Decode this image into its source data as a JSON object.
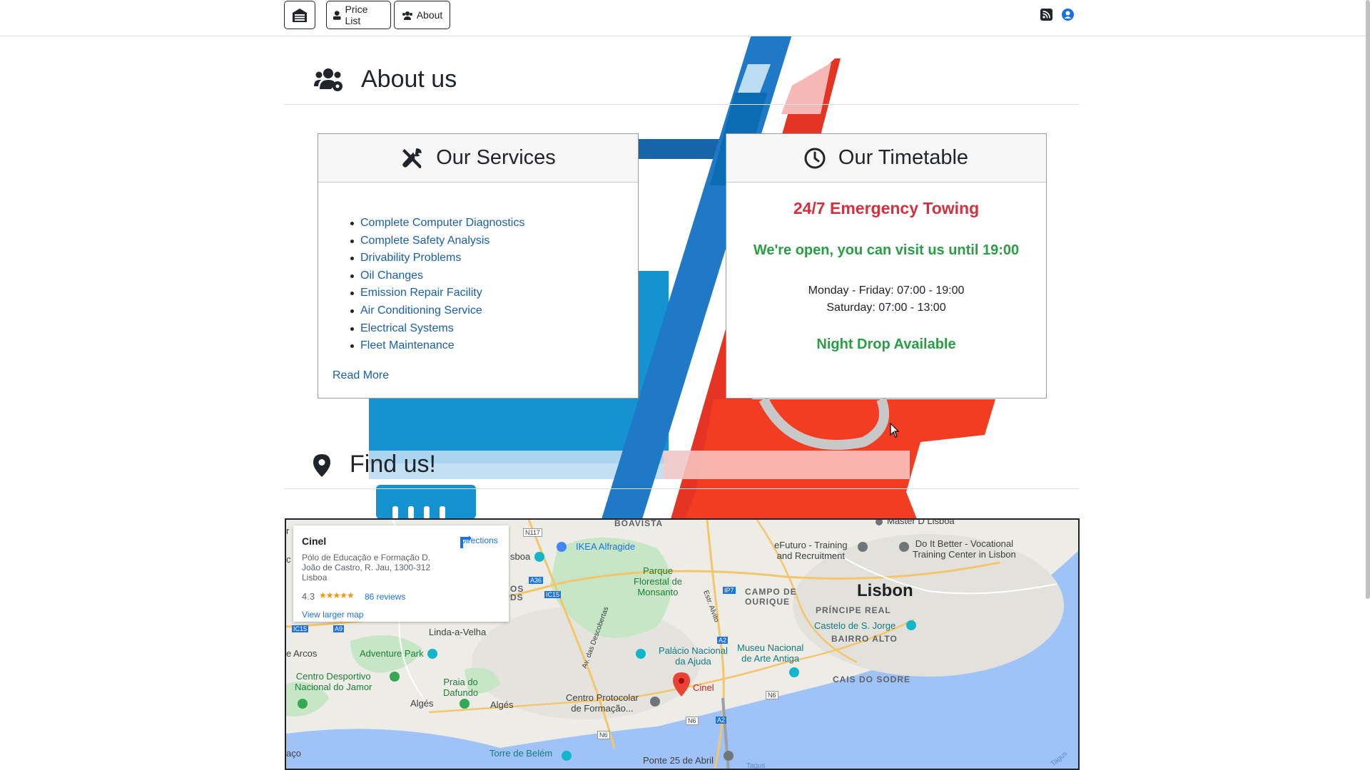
{
  "navbar": {
    "home_icon": "garage-icon",
    "price_list_label": "Price List",
    "about_label": "About",
    "rss_icon": "rss-icon",
    "account_icon": "user-circle-icon"
  },
  "about_section": {
    "title": "About us",
    "icon": "users-gear-icon"
  },
  "services_card": {
    "title": "Our Services",
    "icon": "tools-icon",
    "items": [
      "Complete Computer Diagnostics",
      "Complete Safety Analysis",
      "Drivability Problems",
      "Oil Changes",
      "Emission Repair Facility",
      "Air Conditioning Service",
      "Electrical Systems",
      "Fleet Maintenance"
    ],
    "read_more": "Read More"
  },
  "timetable_card": {
    "title": "Our Timetable",
    "icon": "clock-icon",
    "emergency": "24/7 Emergency Towing",
    "open_status": "We're open, you can visit us until 19:00",
    "weekdays": "Monday - Friday: 07:00 - 19:00",
    "saturday": "Saturday: 07:00 - 13:00",
    "night_drop": "Night Drop Available"
  },
  "find_section": {
    "title": "Find us!",
    "icon": "map-marker-icon"
  },
  "map": {
    "info": {
      "name": "Cinel",
      "address": "Pólo de Educação e Formação D. João de Castro, R. Jau, 1300-312 Lisboa",
      "rating": "4.3",
      "stars": "★★★★★",
      "reviews": "86 reviews",
      "larger_map": "View larger map",
      "directions": "Directions"
    },
    "labels": {
      "lisbon": "Lisbon",
      "boavista": "BOAVISTA",
      "ikea": "IKEA Alfragide",
      "parque_1": "Parque",
      "parque_2": "Florestal de",
      "parque_3": "Monsanto",
      "campo_1": "CAMPO DE",
      "campo_2": "OURIQUE",
      "principe": "PRÍNCIPE REAL",
      "castelo": "Castelo de S. Jorge",
      "bairro": "BAIRRO ALTO",
      "efuturo_1": "eFuturo - Training",
      "efuturo_2": "and Recruitment",
      "doit_1": "Do It Better - Vocational",
      "doit_2": "Training Center in Lisbon",
      "master": "Master D Lisboa",
      "linda": "Linda-a-Velha",
      "adventure": "Adventure Park",
      "arcos": "e Arcos",
      "centro_desp_1": "Centro Desportivo",
      "centro_desp_2": "Nacional do Jamor",
      "praia_1": "Praia do",
      "praia_2": "Dafundo",
      "alges_1": "Algés",
      "alges_2": "Algés",
      "palacio_1": "Palácio Nacional",
      "palacio_2": "da Ajuda",
      "museu_1": "Museu Nacional",
      "museu_2": "de Arte Antiga",
      "cais": "CAIS DO SODRE",
      "centro_prot_1": "Centro Protocolar",
      "centro_prot_2": "de Formação...",
      "cinel": "Cinel",
      "torre": "Torre de Belém",
      "ponte": "Ponte 25 de Abril",
      "tagus_1": "Tagus",
      "tagus_2": "Tagus",
      "av_desc": "Av. das Descobertas",
      "estr": "Estr. Alvito",
      "lisboa_frag": "sboa",
      "os": "OS",
      "ds": "DS",
      "r_frag": "r",
      "c_frag": "c",
      "aco": "aço",
      "road_n117": "N117",
      "road_a36": "A36",
      "road_ic15": "IC15",
      "road_ic15b": "IC15",
      "road_a9": "A9",
      "road_ip7": "IP7",
      "road_a2": "A2",
      "road_a2b": "A2",
      "road_n6": "N6",
      "road_n6b": "N6",
      "road_n6c": "N6"
    },
    "colors": {
      "water": "#9fc3f7",
      "land": "#eeece7",
      "park": "#c6e6c5",
      "road": "#f4c66b",
      "pin": "#ea4335"
    }
  }
}
